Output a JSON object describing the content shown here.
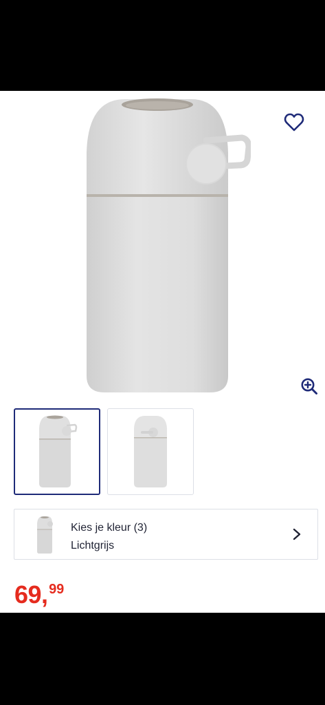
{
  "product": {
    "image_alt": "Luieremmer lichtgrijs",
    "favorite_icon": "heart-outline-icon",
    "zoom_icon": "zoom-in-icon",
    "accent_color": "#1e2a78",
    "price_color": "#e52b1e"
  },
  "thumbnails": [
    {
      "label": "Afbeelding 1",
      "selected": true
    },
    {
      "label": "Afbeelding 2",
      "selected": false
    }
  ],
  "color_picker": {
    "title": "Kies je kleur (3)",
    "selected_value": "Lichtgrijs",
    "chevron_icon": "chevron-right-icon"
  },
  "price": {
    "whole": "69",
    "separator": ",",
    "cents": "99"
  }
}
